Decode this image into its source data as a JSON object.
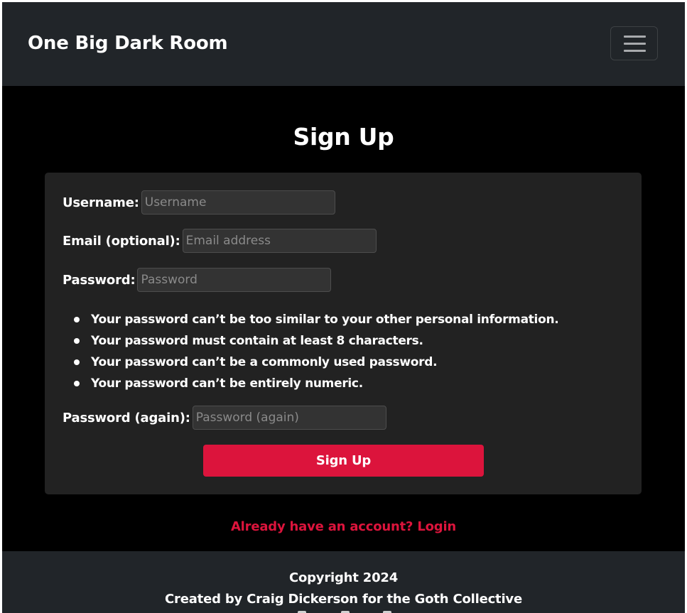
{
  "navbar": {
    "brand": "One Big Dark Room",
    "toggler_icon": "hamburger-menu-icon"
  },
  "page": {
    "title": "Sign Up"
  },
  "form": {
    "username": {
      "label": "Username:",
      "placeholder": "Username",
      "value": ""
    },
    "email": {
      "label": "Email (optional):",
      "placeholder": "Email address",
      "value": ""
    },
    "password": {
      "label": "Password:",
      "placeholder": "Password",
      "value": ""
    },
    "password_help": [
      "Your password can’t be too similar to your other personal information.",
      "Your password must contain at least 8 characters.",
      "Your password can’t be a commonly used password.",
      "Your password can’t be entirely numeric."
    ],
    "password_again": {
      "label": "Password (again):",
      "placeholder": "Password (again)",
      "value": ""
    },
    "submit_label": "Sign Up"
  },
  "login_link": "Already have an account? Login",
  "footer": {
    "copyright": "Copyright 2024",
    "credit": "Created by Craig Dickerson for the Goth Collective",
    "social_icons": [
      "social-icon-1",
      "social-icon-2",
      "social-icon-3"
    ]
  },
  "colors": {
    "accent": "#dc143c",
    "navbar_bg": "#212529",
    "page_bg": "#000000",
    "card_bg": "#222222"
  }
}
